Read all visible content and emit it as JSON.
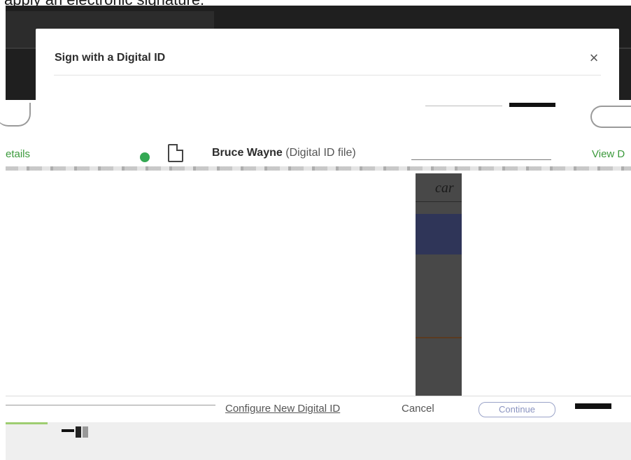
{
  "header": {
    "caption": "apply an electronic signature."
  },
  "dialog": {
    "title": "Sign with a Digital ID",
    "close_glyph": "×"
  },
  "id_row": {
    "details_label": "etails",
    "name": "Bruce Wayne",
    "source": "(Digital ID file)",
    "view_label": "View D"
  },
  "preview": {
    "text": "car"
  },
  "footer": {
    "configure_label": "Configure New Digital ID",
    "cancel_label": "Cancel",
    "continue_label": "Continue"
  }
}
